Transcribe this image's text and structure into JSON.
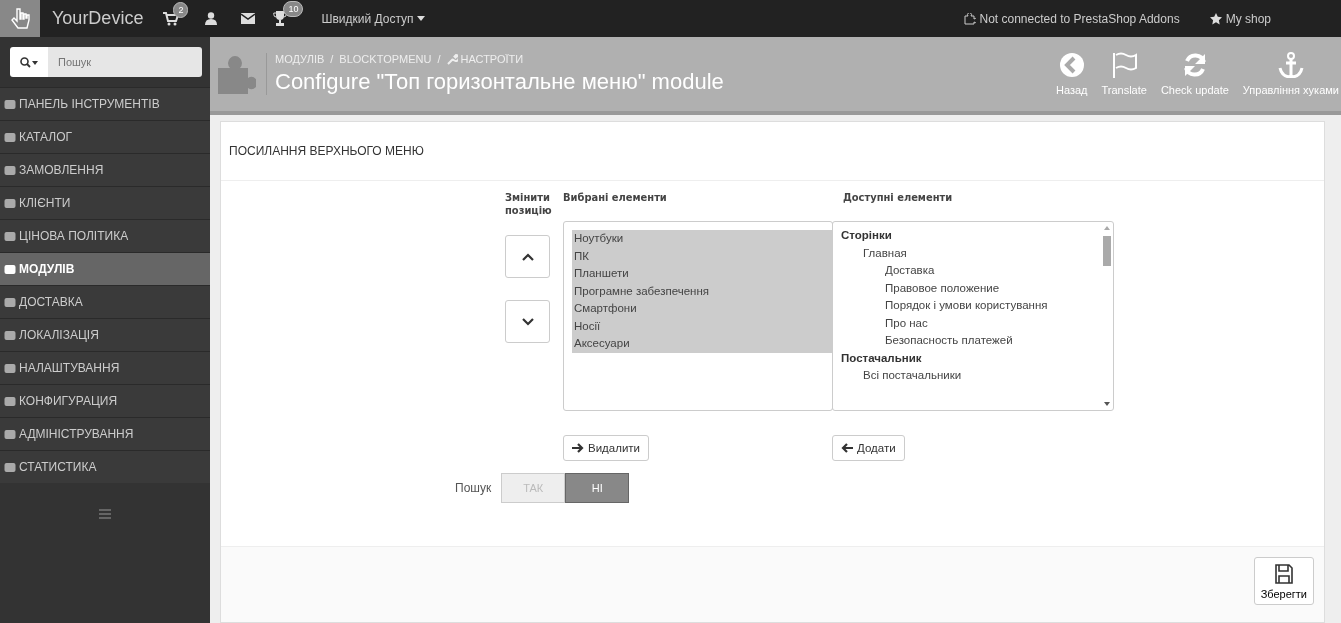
{
  "topbar": {
    "brand": "YourDevice",
    "cart_badge": "2",
    "trophy_badge": "10",
    "quick_access": "Швидкий Доступ",
    "addons_status": "Not connected to PrestaShop Addons",
    "my_shop": "My shop"
  },
  "search": {
    "placeholder": "Пошук"
  },
  "sidebar": {
    "items": [
      {
        "label": "ПАНЕЛЬ ІНСТРУМЕНТІВ",
        "selected": false
      },
      {
        "label": "КАТАЛОГ",
        "selected": false
      },
      {
        "label": "ЗАМОВЛЕННЯ",
        "selected": false
      },
      {
        "label": "КЛІЄНТИ",
        "selected": false
      },
      {
        "label": "ЦІНОВА ПОЛІТИКА",
        "selected": false
      },
      {
        "label": "МОДУЛІВ",
        "selected": true
      },
      {
        "label": "ДОСТАВКА",
        "selected": false
      },
      {
        "label": "ЛОКАЛІЗАЦІЯ",
        "selected": false
      },
      {
        "label": "НАЛАШТУВАННЯ",
        "selected": false
      },
      {
        "label": "КОНФИГУРАЦИЯ",
        "selected": false
      },
      {
        "label": "АДМІНІСТРУВАННЯ",
        "selected": false
      },
      {
        "label": "СТАТИСТИКА",
        "selected": false
      }
    ]
  },
  "header": {
    "breadcrumbs": [
      "МОДУЛІВ",
      "BLOCKTOPMENU",
      "НАСТРОЇТИ"
    ],
    "breadcrumb_separator": "/",
    "title": "Configure \"Топ горизонтальне меню\" module",
    "actions": [
      "Назад",
      "Translate",
      "Check update",
      "Управління хуками"
    ]
  },
  "panel": {
    "title": "ПОСИЛАННЯ ВЕРХНЬОГО МЕНЮ",
    "position_label": "Змінити позицію",
    "selected_label": "Вибрані елементи",
    "available_label": "Доступні елементи",
    "selected_items": [
      {
        "label": "Ноутбуки",
        "selected": true
      },
      {
        "label": "ПК",
        "selected": true
      },
      {
        "label": "Планшети",
        "selected": true
      },
      {
        "label": "Програмне забезпечення",
        "selected": true
      },
      {
        "label": "Смартфони",
        "selected": true
      },
      {
        "label": "Носії",
        "selected": true
      },
      {
        "label": "Аксесуари",
        "selected": true
      }
    ],
    "available_items": [
      {
        "label": "Сторінки",
        "children": [
          {
            "label": "Главная",
            "children": [
              {
                "label": "Доставка"
              },
              {
                "label": "Правовое положение"
              },
              {
                "label": "Порядок і умови користування"
              },
              {
                "label": "Про нас"
              },
              {
                "label": "Безопасность платежей"
              }
            ]
          }
        ]
      },
      {
        "label": "Постачальник",
        "children": [
          {
            "label": "Всі постачальники"
          }
        ]
      }
    ],
    "remove_button": "Видалити",
    "add_button": "Додати",
    "search_label": "Пошук",
    "search_options": [
      {
        "label": "ТАК",
        "selected": false
      },
      {
        "label": "НІ",
        "selected": true
      }
    ],
    "save_button": "Зберегти"
  }
}
